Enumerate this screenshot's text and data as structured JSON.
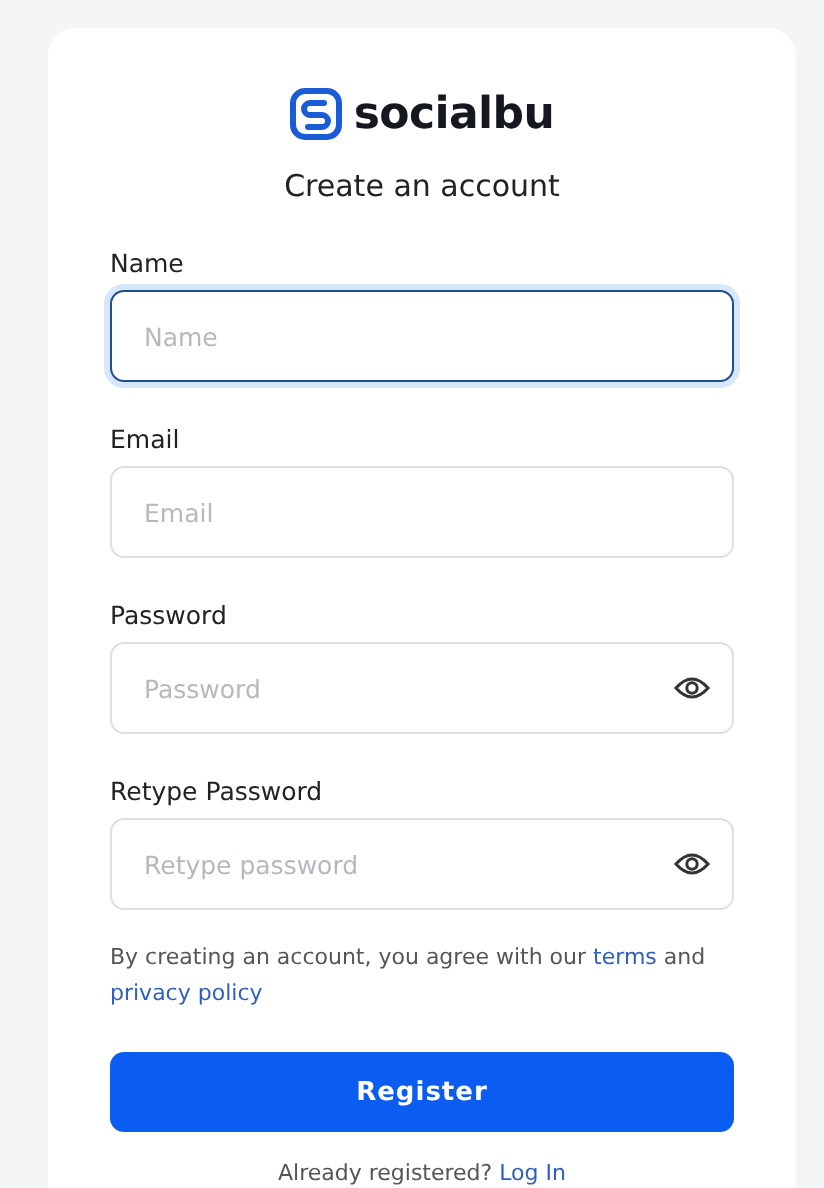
{
  "logo": {
    "text": "socialbu"
  },
  "heading": "Create an account",
  "fields": [
    {
      "label": "Name",
      "placeholder": "Name",
      "kind": "text",
      "focused": true
    },
    {
      "label": "Email",
      "placeholder": "Email",
      "kind": "text",
      "focused": false
    },
    {
      "label": "Password",
      "placeholder": "Password",
      "kind": "password",
      "focused": false
    },
    {
      "label": "Retype Password",
      "placeholder": "Retype password",
      "kind": "password",
      "focused": false
    }
  ],
  "agreement": {
    "text": "By creating an account, you agree with our",
    "terms_link": "terms",
    "joiner": "and",
    "privacy_link": "privacy policy"
  },
  "register_button": "Register",
  "login_prompt": {
    "text": "Already registered?",
    "link": "Log In"
  }
}
